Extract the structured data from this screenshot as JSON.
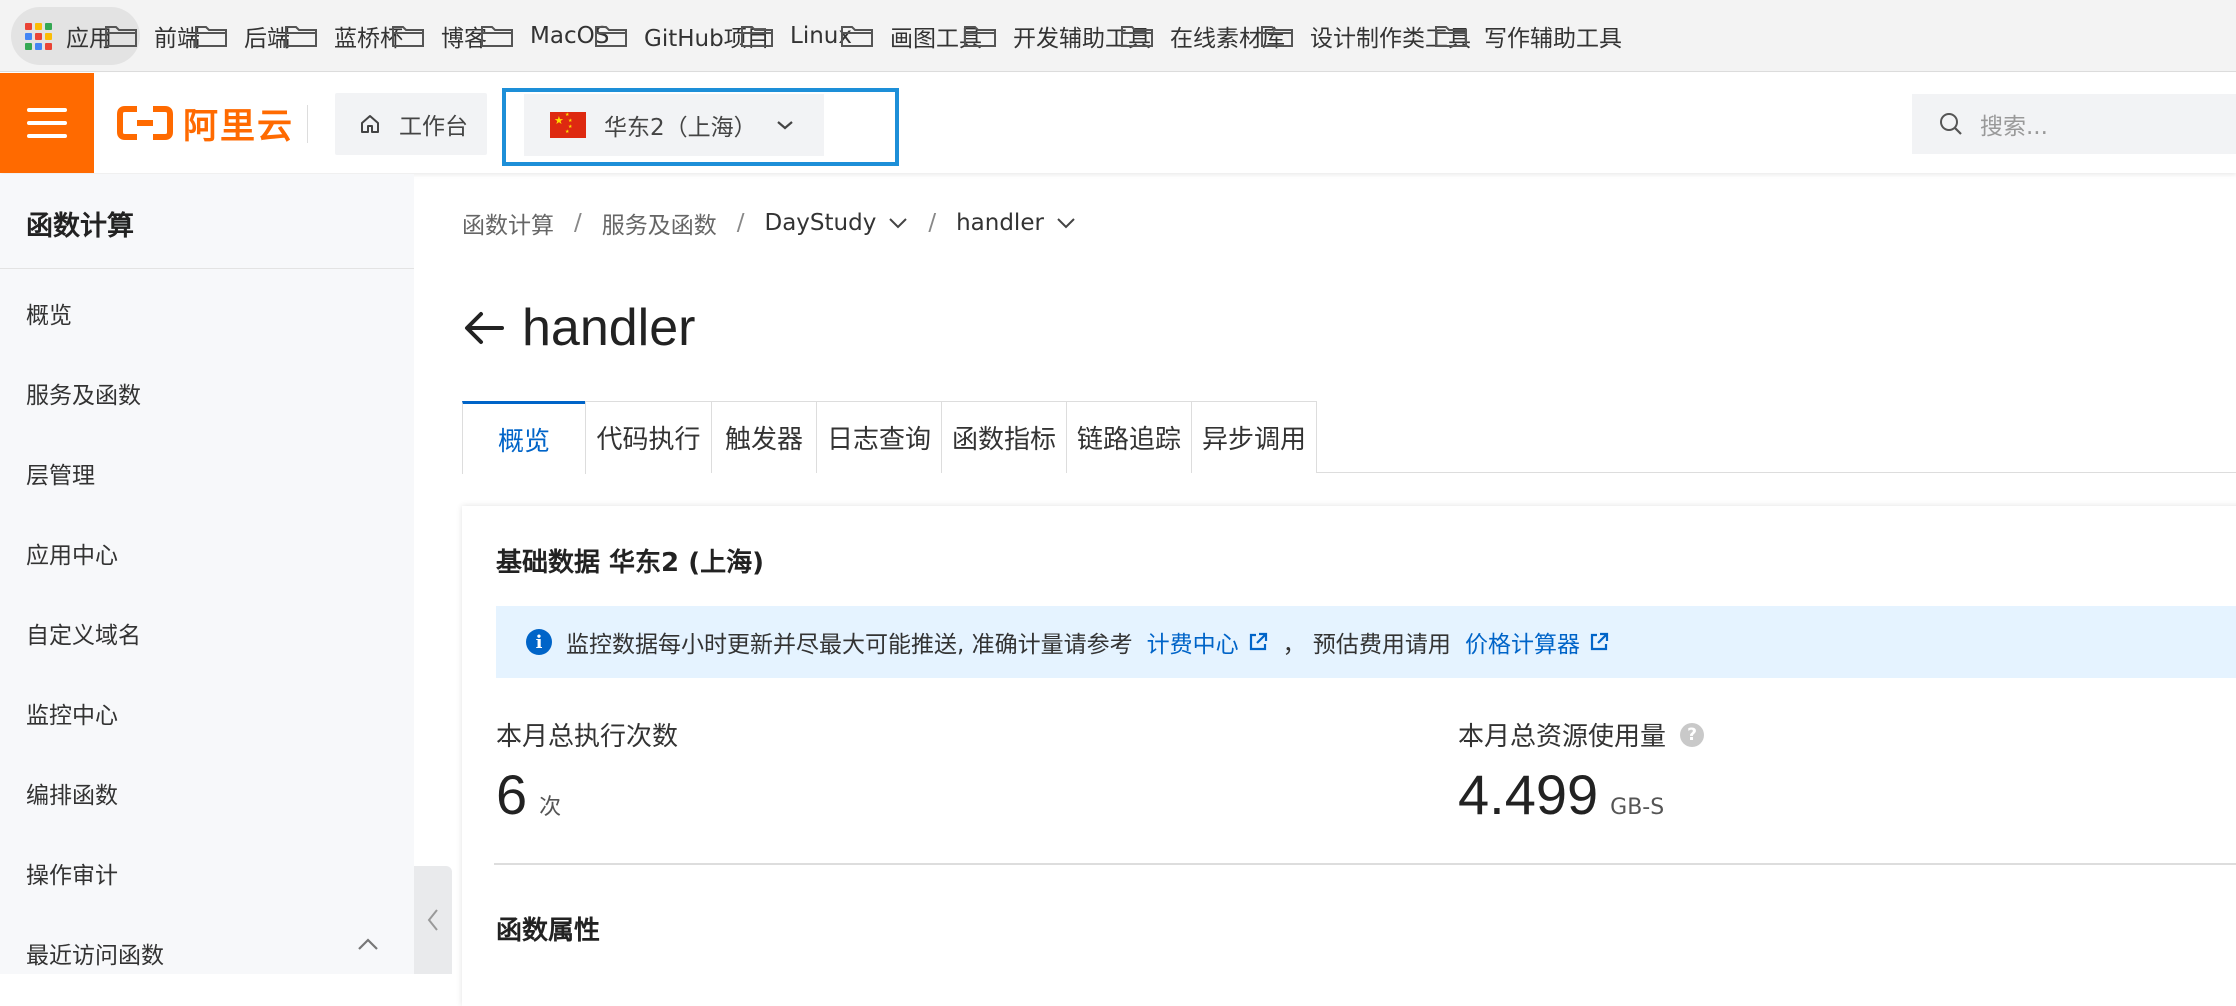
{
  "bookmarks": {
    "apps_label": "应用",
    "apps_icon": "apps-grid-icon",
    "folders": [
      "前端",
      "后端",
      "蓝桥杯",
      "博客",
      "MacOS",
      "GitHub项目",
      "Linux",
      "画图工具",
      "开发辅助工具",
      "在线素材库",
      "设计制作类工具",
      "写作辅助工具"
    ],
    "folder_icon": "folder-icon"
  },
  "header": {
    "menu_icon": "hamburger-menu-icon",
    "brand_name": "阿里云",
    "brand_color": "#ff6a00",
    "workbench_label": "工作台",
    "workbench_icon": "home-icon",
    "region_label": "华东2（上海）",
    "region_icon": "china-flag-icon",
    "search_placeholder": "搜索...",
    "search_icon": "search-icon"
  },
  "sidebar": {
    "title": "函数计算",
    "items": [
      "概览",
      "服务及函数",
      "层管理",
      "应用中心",
      "自定义域名",
      "监控中心",
      "编排函数",
      "操作审计",
      "最近访问函数"
    ]
  },
  "breadcrumb": {
    "items": [
      "函数计算",
      "服务及函数",
      "DayStudy",
      "handler"
    ],
    "separator": "/"
  },
  "page": {
    "title": "handler",
    "back_icon": "arrow-left-icon"
  },
  "tabs": {
    "items": [
      "概览",
      "代码执行",
      "触发器",
      "日志查询",
      "函数指标",
      "链路追踪",
      "异步调用"
    ],
    "active_index": 0,
    "accent_color": "#0064c8"
  },
  "overview": {
    "card_title": "基础数据 华东2 (上海)",
    "notice_text": "监控数据每小时更新并尽最大可能推送, 准确计量请参考",
    "notice_link1": "计费中心",
    "notice_middle": "， 预估费用请用",
    "notice_link2": "价格计算器",
    "stats": [
      {
        "label": "本月总执行次数",
        "value": "6",
        "unit": "次"
      },
      {
        "label": "本月总资源使用量",
        "value": "4.499",
        "unit": "GB-S"
      }
    ],
    "section_title": "函数属性"
  }
}
